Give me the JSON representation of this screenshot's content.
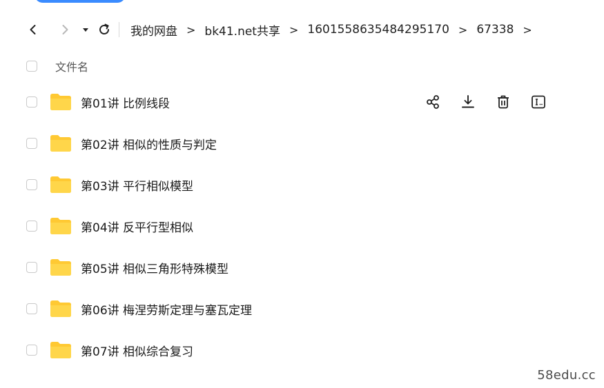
{
  "nav": {
    "back_icon": "chevron-left-icon",
    "forward_icon": "chevron-right-icon",
    "history_icon": "caret-down-icon",
    "refresh_icon": "refresh-icon"
  },
  "breadcrumb": {
    "items": [
      "我的网盘",
      "bk41.net共享",
      "1601558635484295170",
      "67338"
    ],
    "separator": ">"
  },
  "table": {
    "header": {
      "name_label": "文件名"
    },
    "rows": [
      {
        "name": "第01讲 比例线段",
        "icon": "folder-icon",
        "hovered": true
      },
      {
        "name": "第02讲 相似的性质与判定",
        "icon": "folder-icon"
      },
      {
        "name": "第03讲 平行相似模型",
        "icon": "folder-icon"
      },
      {
        "name": "第04讲 反平行型相似",
        "icon": "folder-icon"
      },
      {
        "name": "第05讲 相似三角形特殊模型",
        "icon": "folder-icon"
      },
      {
        "name": "第06讲 梅涅劳斯定理与塞瓦定理",
        "icon": "folder-icon"
      },
      {
        "name": "第07讲 相似综合复习",
        "icon": "folder-icon"
      }
    ]
  },
  "row_actions": [
    "share-icon",
    "download-icon",
    "delete-icon",
    "rename-icon"
  ],
  "watermark": {
    "text": "58edu.cc"
  },
  "colors": {
    "accent": "#3a8bff",
    "folder": "#ffc933",
    "text": "#1a1a1a",
    "checkbox_border": "#c9c9c9"
  }
}
